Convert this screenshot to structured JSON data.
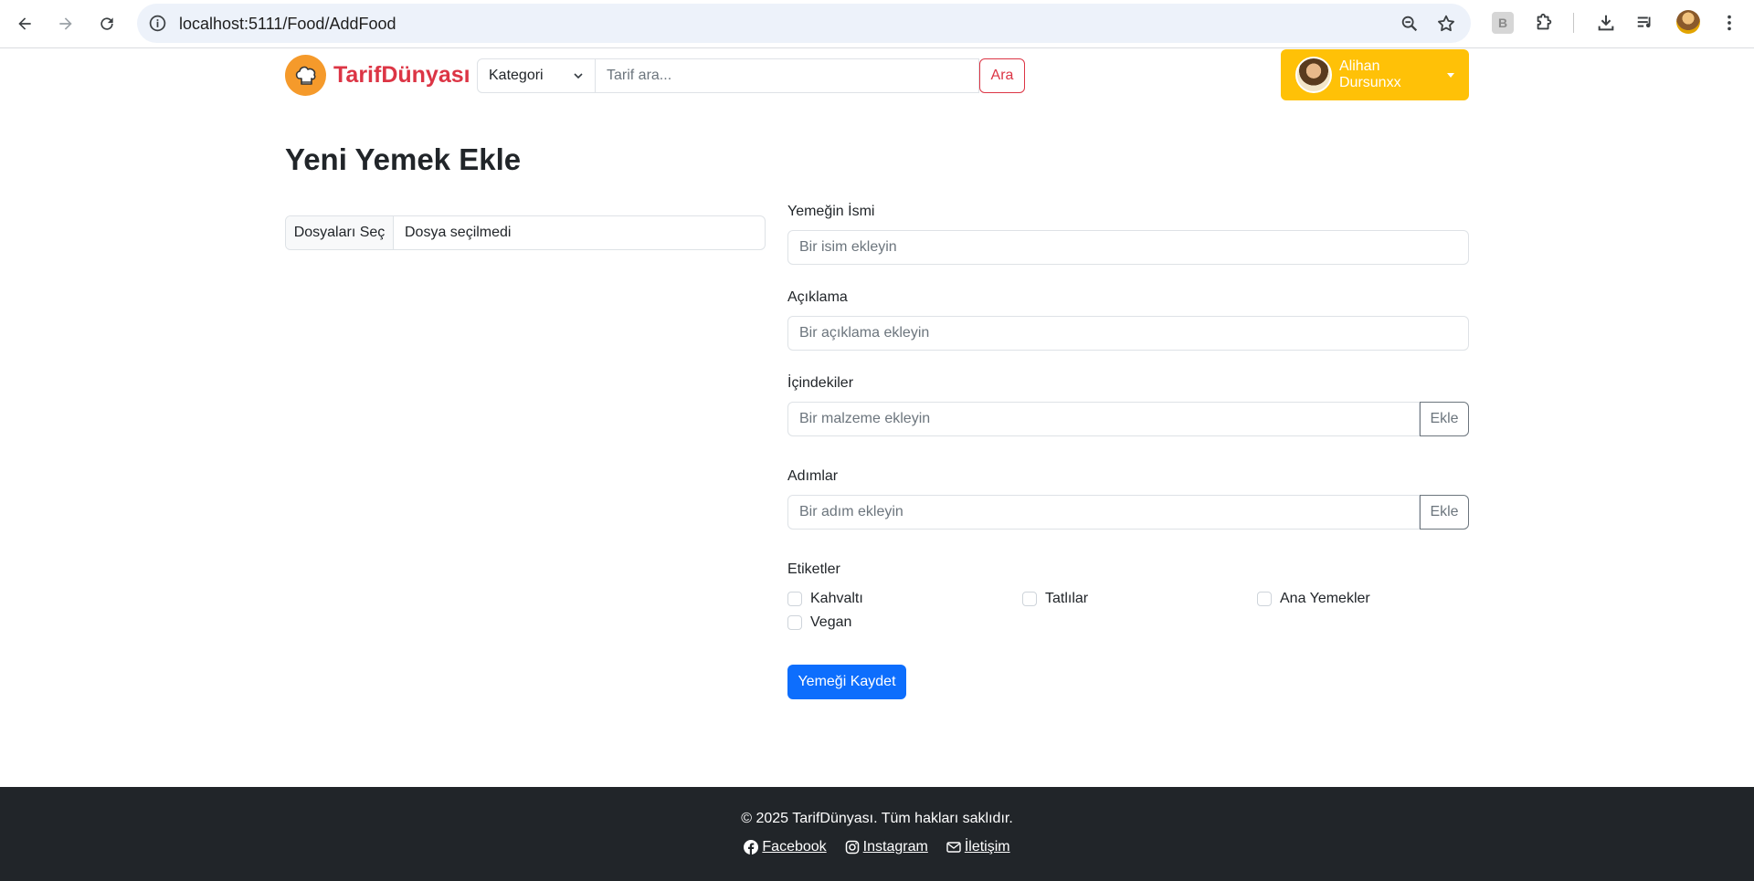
{
  "browser": {
    "url": "localhost:5111/Food/AddFood"
  },
  "navbar": {
    "brand": "TarifDünyası",
    "category_select": "Kategori",
    "search_placeholder": "Tarif ara...",
    "search_button": "Ara",
    "user_name": "Alihan Dursunxx"
  },
  "page": {
    "title": "Yeni Yemek Ekle",
    "file_button": "Dosyaları Seç",
    "file_status": "Dosya seçilmedi"
  },
  "form": {
    "name_label": "Yemeğin İsmi",
    "name_placeholder": "Bir isim ekleyin",
    "description_label": "Açıklama",
    "description_placeholder": "Bir açıklama ekleyin",
    "ingredients_label": "İçindekiler",
    "ingredients_placeholder": "Bir malzeme ekleyin",
    "ingredients_add": "Ekle",
    "steps_label": "Adımlar",
    "steps_placeholder": "Bir adım ekleyin",
    "steps_add": "Ekle",
    "tags_label": "Etiketler",
    "tags": [
      "Kahvaltı",
      "Tatlılar",
      "Ana Yemekler",
      "Vegan"
    ],
    "save_button": "Yemeği Kaydet"
  },
  "footer": {
    "copyright": "© 2025 TarifDünyası. Tüm hakları saklıdır.",
    "links": [
      "Facebook",
      "Instagram",
      "İletişim"
    ]
  },
  "colors": {
    "brand_red": "#dc3545",
    "user_yellow": "#ffc107",
    "primary_blue": "#0d6efd",
    "footer_dark": "#212529"
  }
}
